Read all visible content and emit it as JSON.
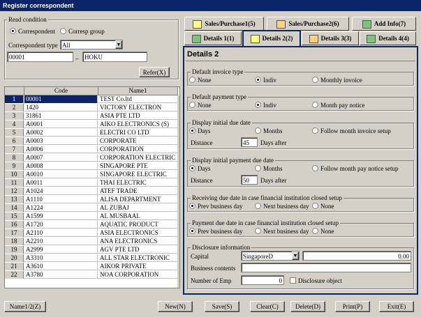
{
  "window": {
    "title": "Register correspondent"
  },
  "read_condition": {
    "label": "Read condition",
    "options": [
      "Correspondent",
      "Corresp group"
    ],
    "type_label": "Correspondent type",
    "type_value": "All",
    "from_code": "00001",
    "separator": "_",
    "to_code": "HOKU",
    "refer_button": "Refer(X)"
  },
  "grid": {
    "col_code": "Code",
    "col_name": "Name1",
    "rows": [
      {
        "n": "1",
        "code": "00001",
        "name": "TEST Co.ltd"
      },
      {
        "n": "2",
        "code": "1420",
        "name": "VICTORY ELECTRON"
      },
      {
        "n": "3",
        "code": "31861",
        "name": "ASIA PTE LTD"
      },
      {
        "n": "4",
        "code": "A0001",
        "name": "AIKO ELECTRONICS (S)"
      },
      {
        "n": "5",
        "code": "A0002",
        "name": "ELECTRI CO LTD"
      },
      {
        "n": "6",
        "code": "A0003",
        "name": "CORPORATE"
      },
      {
        "n": "7",
        "code": "A0006",
        "name": "CORPORATION"
      },
      {
        "n": "8",
        "code": "A0007",
        "name": "CORPORATION ELECTRIC"
      },
      {
        "n": "9",
        "code": "A0008",
        "name": "SINGAPORE PTE"
      },
      {
        "n": "10",
        "code": "A0010",
        "name": "SINGAPORE ELECTRIC"
      },
      {
        "n": "11",
        "code": "A0011",
        "name": "THAI ELECTRIC"
      },
      {
        "n": "12",
        "code": "A1024",
        "name": "ATEF TRADE"
      },
      {
        "n": "13",
        "code": "A1110",
        "name": "ALISA   DEPARTMENT"
      },
      {
        "n": "14",
        "code": "A1224",
        "name": "AL ZUBAJ"
      },
      {
        "n": "15",
        "code": "A1599",
        "name": "AL MUSBAAL"
      },
      {
        "n": "16",
        "code": "A1720",
        "name": "AQUATIC PRODUCT"
      },
      {
        "n": "17",
        "code": "A2110",
        "name": "ASIA ELECTRONICS"
      },
      {
        "n": "18",
        "code": "A2210",
        "name": "ANA ELECTRONICS"
      },
      {
        "n": "19",
        "code": "A2999",
        "name": "AGV PTE LTD"
      },
      {
        "n": "20",
        "code": "A3310",
        "name": "ALL STAR ELECTRONIC"
      },
      {
        "n": "21",
        "code": "A3610",
        "name": "AIKOR PRIVATE"
      },
      {
        "n": "22",
        "code": "A3780",
        "name": "NOA CORPORATION"
      }
    ]
  },
  "tabs": {
    "sales1": "Sales/Purchase1(5)",
    "sales2": "Sales/Purchase2(6)",
    "addinfo": "Add Info(7)",
    "d1": "Details 1(1)",
    "d2": "Details 2(2)",
    "d3": "Details 3(3)",
    "d4": "Details 4(4)"
  },
  "details": {
    "title": "Details 2",
    "invoice": {
      "label": "Default invoice type",
      "none": "None",
      "indiv": "Indiv",
      "monthly": "Monthly invoice"
    },
    "payment": {
      "label": "Default payment type",
      "none": "None",
      "indiv": "Indiv",
      "notice": "Month pay notice"
    },
    "invoice_due": {
      "label": "Display initial due date",
      "days": "Days",
      "months": "Months",
      "follow": "Follow month invoice setup",
      "distance_label": "Distance",
      "distance": "45",
      "after": "Days after"
    },
    "pay_due": {
      "label": "Display initial payment due date",
      "days": "Days",
      "months": "Months",
      "follow": "Follow month pay notice setup",
      "distance_label": "Distance",
      "distance": "50",
      "after": "Days after"
    },
    "recv_closed": {
      "label": "Receiving due date in case financial institution closed setup",
      "prev": "Prev business day",
      "next": "Next business day",
      "none": "None"
    },
    "pay_closed": {
      "label": "Payment due date in case financial institution closed setup",
      "prev": "Prev business day",
      "next": "Next business day",
      "none": "None"
    },
    "disclosure": {
      "label": "Disclosure information",
      "capital_label": "Capital",
      "currency": "SingaporeD",
      "capital": "0.00",
      "contents_label": "Business contents",
      "contents": "",
      "emp_label": "Number of Emp",
      "emp": "0",
      "object_label": "Disclosure object"
    }
  },
  "footer": {
    "name_button": "Name1/2(Z)",
    "new": "New(N)",
    "save": "Save(S)",
    "clear": "Clear(C)",
    "delete": "Delete(D)",
    "print": "Print(P)",
    "exit": "Exit(E)"
  },
  "colors": {
    "title_bar": "#0a246a",
    "selected_row": "#0a246a",
    "panel_border": "#0a246a"
  }
}
